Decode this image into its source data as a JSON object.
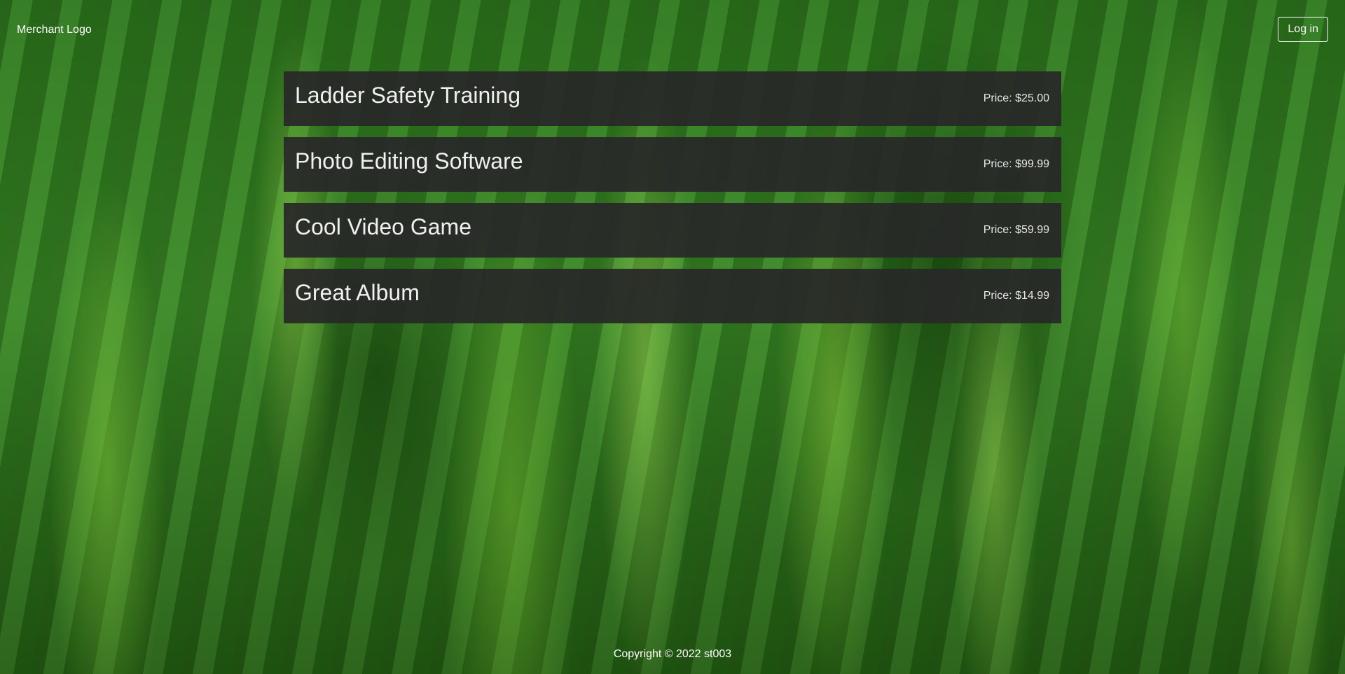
{
  "header": {
    "logo_text": "Merchant Logo",
    "login_label": "Log in"
  },
  "products": [
    {
      "name": "Ladder Safety Training",
      "price": "Price: $25.00"
    },
    {
      "name": "Photo Editing Software",
      "price": "Price: $99.99"
    },
    {
      "name": "Cool Video Game",
      "price": "Price: $59.99"
    },
    {
      "name": "Great Album",
      "price": "Price: $14.99"
    }
  ],
  "footer": {
    "copyright": "Copyright © 2022 st003"
  },
  "colors": {
    "card_background": "#282828",
    "text": "#ffffff"
  }
}
